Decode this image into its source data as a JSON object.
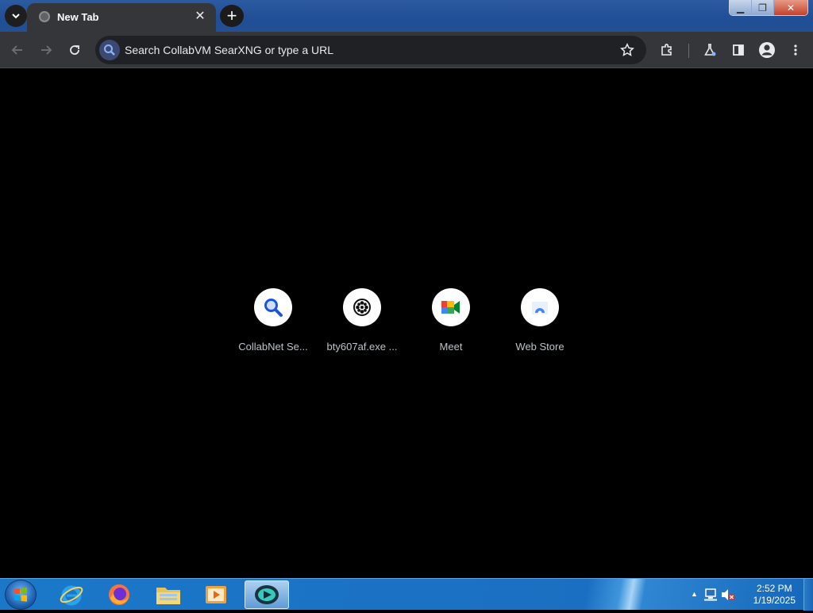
{
  "browser": {
    "tab": {
      "title": "New Tab",
      "close_glyph": "✕"
    },
    "new_tab_glyph": "+",
    "window_controls": {
      "minimize": "▁",
      "maximize": "❐",
      "close": "✕"
    },
    "omnibox": {
      "placeholder": "Search CollabVM SearXNG or type a URL"
    }
  },
  "new_tab_page": {
    "shortcuts": [
      {
        "label": "CollabNet Se...",
        "icon": "search-icon"
      },
      {
        "label": "bty607af.exe ...",
        "icon": "film-reel-icon"
      },
      {
        "label": "Meet",
        "icon": "meet-icon"
      },
      {
        "label": "Web Store",
        "icon": "web-store-icon"
      }
    ]
  },
  "taskbar": {
    "apps": [
      "internet-explorer-icon",
      "firefox-icon",
      "file-explorer-icon",
      "media-player-icon",
      "collabvm-app-icon"
    ],
    "tray": {
      "arrow": "▲"
    },
    "clock": {
      "time": "2:52 PM",
      "date": "1/19/2025"
    }
  },
  "colors": {
    "tab_bg": "#35363a",
    "page_bg": "#000000",
    "omnibox_bg": "#202124",
    "title_bar": "#1f4f96"
  }
}
